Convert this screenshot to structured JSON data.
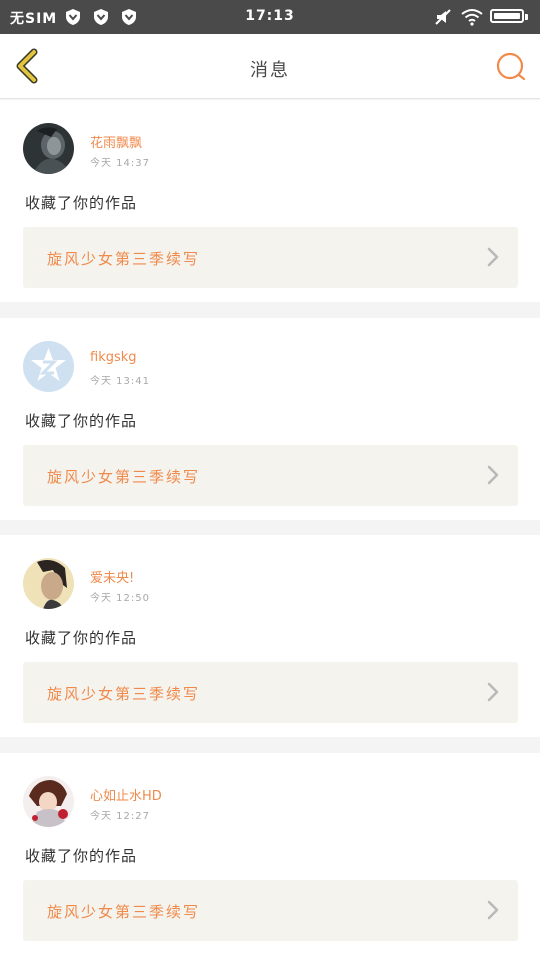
{
  "status_bar": {
    "carrier": "无SIM",
    "time": "17:13",
    "icons": [
      "vpn-shield-icon",
      "vpn-shield-icon",
      "vpn-shield-icon",
      "mute-icon",
      "wifi-icon",
      "battery-icon"
    ]
  },
  "header": {
    "title": "消息",
    "back_icon": "chevron-left-icon",
    "search_icon": "search-icon"
  },
  "colors": {
    "accent": "#f08a4b",
    "back_arrow": "#d8b93a",
    "status_bar": "#4a4a4a"
  },
  "messages": [
    {
      "username": "花雨飘飘",
      "time": "今天 14:37",
      "action": "收藏了你的作品",
      "work_title": "旋风少女第三季续写",
      "avatar": "photo-avatar"
    },
    {
      "username": "fikgskg",
      "time": "今天 13:41",
      "action": "收藏了你的作品",
      "work_title": "旋风少女第三季续写",
      "avatar": "default-avatar"
    },
    {
      "username": "爱未央!",
      "time": "今天 12:50",
      "action": "收藏了你的作品",
      "work_title": "旋风少女第三季续写",
      "avatar": "photo-avatar"
    },
    {
      "username": "心如止水HD",
      "time": "今天 12:27",
      "action": "收藏了你的作品",
      "work_title": "旋风少女第三季续写",
      "avatar": "anime-avatar"
    }
  ]
}
